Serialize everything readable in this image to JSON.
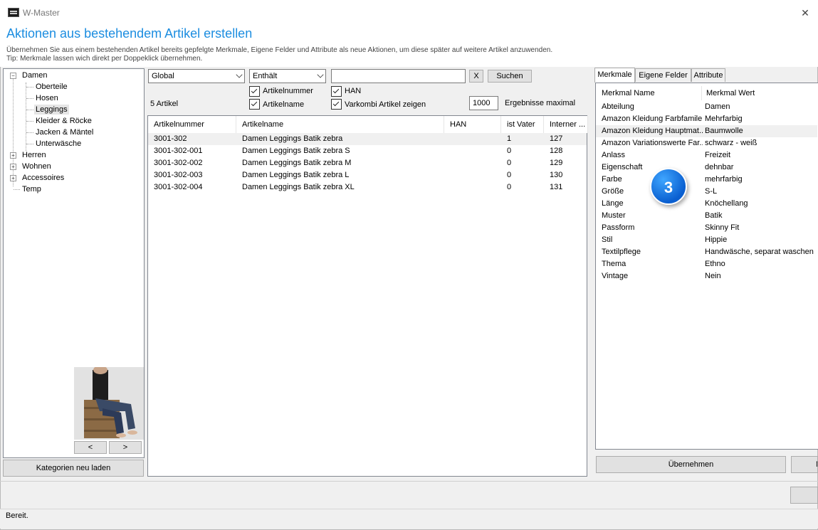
{
  "window": {
    "title": "W-Master",
    "close_symbol": "✕",
    "heading": "Aktionen aus bestehendem Artikel erstellen",
    "description_line1": "Übernehmen Sie aus einem bestehenden Artikel bereits gepfelgte Merkmale, Eigene Felder und Attribute als neue Aktionen, um diese später auf weitere Artikel anzuwenden.",
    "description_line2": "Tip: Merkmale lassen wich direkt per Doppeklick übernehmen."
  },
  "tree": {
    "items": [
      {
        "label": "Damen",
        "level": 0,
        "expander": "−"
      },
      {
        "label": "Oberteile",
        "level": 1
      },
      {
        "label": "Hosen",
        "level": 1
      },
      {
        "label": "Leggings",
        "level": 1,
        "selected": true
      },
      {
        "label": "Kleider & Röcke",
        "level": 1
      },
      {
        "label": "Jacken & Mäntel",
        "level": 1
      },
      {
        "label": "Unterwäsche",
        "level": 1
      },
      {
        "label": "Herren",
        "level": 0,
        "expander": "+"
      },
      {
        "label": "Wohnen",
        "level": 0,
        "expander": "+"
      },
      {
        "label": "Accessoires",
        "level": 0,
        "expander": "+"
      },
      {
        "label": "Temp",
        "level": 0
      }
    ],
    "prev_label": "<",
    "next_label": ">",
    "reload_label": "Kategorien neu laden"
  },
  "search": {
    "scope_value": "Global",
    "mode_value": "Enthält",
    "query_value": "",
    "clear_label": "X",
    "search_label": "Suchen",
    "check_artikelnummer": "Artikelnummer",
    "check_artikelname": "Artikelname",
    "check_han": "HAN",
    "check_varkombi": "Varkombi Artikel zeigen",
    "result_count": "5 Artikel",
    "max_results_value": "1000",
    "max_results_label": "Ergebnisse maximal"
  },
  "grid": {
    "columns": [
      "Artikelnummer",
      "Artikelname",
      "HAN",
      "ist Vater",
      "Interner ..."
    ],
    "rows": [
      [
        "3001-302",
        "Damen Leggings  Batik zebra",
        "",
        "1",
        "127"
      ],
      [
        "3001-302-001",
        "Damen Leggings  Batik zebra S",
        "",
        "0",
        "128"
      ],
      [
        "3001-302-002",
        "Damen Leggings  Batik zebra M",
        "",
        "0",
        "129"
      ],
      [
        "3001-302-003",
        "Damen Leggings  Batik zebra L",
        "",
        "0",
        "130"
      ],
      [
        "3001-302-004",
        "Damen Leggings  Batik zebra XL",
        "",
        "0",
        "131"
      ]
    ]
  },
  "tabs": [
    "Merkmale",
    "Eigene Felder",
    "Attribute"
  ],
  "properties": {
    "header_name": "Merkmal Name",
    "header_value": "Merkmal Wert",
    "rows": [
      [
        "Abteilung",
        "Damen"
      ],
      [
        "Amazon Kleidung Farbfamile",
        "Mehrfarbig"
      ],
      [
        "Amazon Kleidung Hauptmat...",
        "Baumwolle"
      ],
      [
        "Amazon Variationswerte Far...",
        "schwarz - weiß"
      ],
      [
        "Anlass",
        "Freizeit"
      ],
      [
        "Eigenschaft",
        "dehnbar"
      ],
      [
        "Farbe",
        "mehrfarbig"
      ],
      [
        "Größe",
        "S-L"
      ],
      [
        "Länge",
        "Knöchellang"
      ],
      [
        "Muster",
        "Batik"
      ],
      [
        "Passform",
        "Skinny Fit"
      ],
      [
        "Stil",
        "Hippie"
      ],
      [
        "Textilpflege",
        "Handwäsche, separat waschen"
      ],
      [
        "Thema",
        "Ethno"
      ],
      [
        "Vintage",
        "Nein"
      ]
    ],
    "apply_label": "Übernehmen",
    "next_button_partial": "N"
  },
  "badge": "3",
  "status": "Bereit.",
  "colors": {
    "accent": "#1c8de0",
    "badge": "#0a6fe0"
  }
}
